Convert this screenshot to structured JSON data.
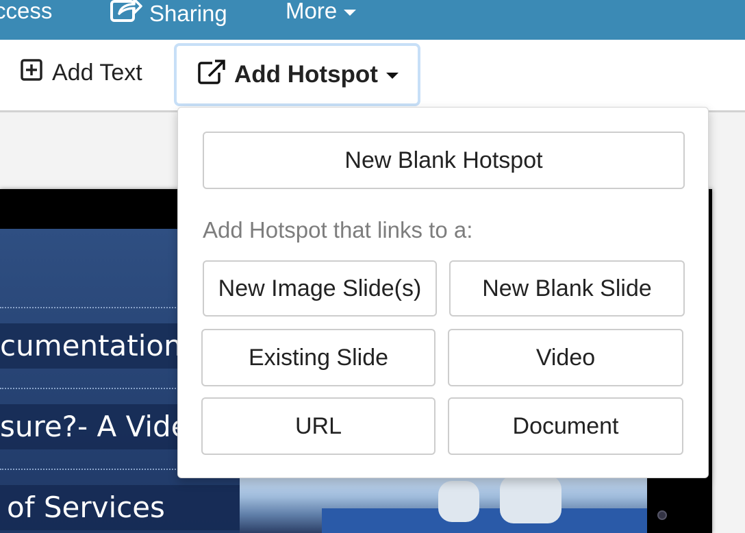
{
  "topnav": {
    "items": [
      {
        "label": "ccess",
        "icon": "none"
      },
      {
        "label": "Sharing",
        "icon": "share-icon"
      },
      {
        "label": "More",
        "icon": "caret-down-icon"
      }
    ],
    "background": "#3b8ab5"
  },
  "toolbar": {
    "add_text_label": "Add Text",
    "add_hotspot_label": "Add Hotspot"
  },
  "dropdown": {
    "new_blank_hotspot": "New Blank Hotspot",
    "links_heading": "Add Hotspot that links to a:",
    "options": [
      "New Image Slide(s)",
      "New Blank Slide",
      "Existing Slide",
      "Video",
      "URL",
      "Document"
    ]
  },
  "slide": {
    "menu_items": [
      "cumentation",
      "sure?- A Video",
      "of Services"
    ]
  },
  "colors": {
    "accent": "#3b8ab5",
    "focus_ring": "#c7dff7",
    "slide_blue": "#2f4f82"
  }
}
